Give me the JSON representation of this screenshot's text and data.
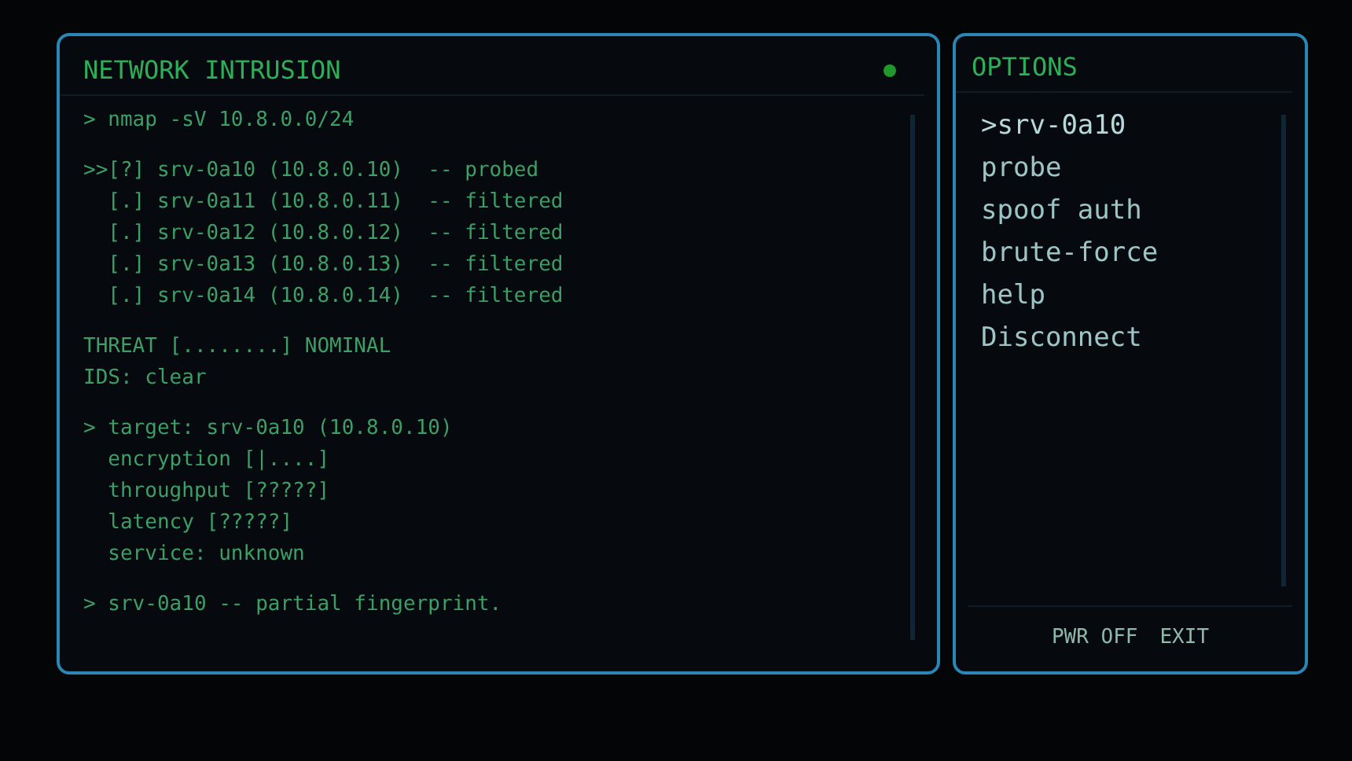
{
  "terminal": {
    "title": "NETWORK INTRUSION",
    "blocks": [
      [
        "> nmap -sV 10.8.0.0/24"
      ],
      [
        ">>[?] srv-0a10 (10.8.0.10)  -- probed",
        "  [.] srv-0a11 (10.8.0.11)  -- filtered",
        "  [.] srv-0a12 (10.8.0.12)  -- filtered",
        "  [.] srv-0a13 (10.8.0.13)  -- filtered",
        "  [.] srv-0a14 (10.8.0.14)  -- filtered"
      ],
      [
        "THREAT [........] NOMINAL",
        "IDS: clear"
      ],
      [
        "> target: srv-0a10 (10.8.0.10)",
        "  encryption [|....]",
        "  throughput [?????]",
        "  latency [?????]",
        "  service: unknown"
      ],
      [
        "> srv-0a10 -- partial fingerprint."
      ]
    ]
  },
  "options": {
    "title": "OPTIONS",
    "cursor": ">",
    "items": [
      {
        "label": "srv-0a10",
        "selected": true
      },
      {
        "label": "probe",
        "selected": false
      },
      {
        "label": "spoof auth",
        "selected": false
      },
      {
        "label": "brute-force",
        "selected": false
      },
      {
        "label": "help",
        "selected": false
      },
      {
        "label": "Disconnect",
        "selected": false
      }
    ],
    "footer": [
      "PWR OFF",
      "EXIT"
    ]
  }
}
